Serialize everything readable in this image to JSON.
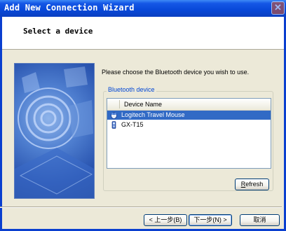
{
  "window": {
    "title": "Add New Connection Wizard",
    "close_symbol": "✕"
  },
  "header": {
    "title": "Select a device"
  },
  "main": {
    "prompt": "Please choose the Bluetooth device you wish to use.",
    "group_label": "Bluetooth device",
    "list": {
      "column_header": "Device Name",
      "items": [
        {
          "label": "Logitech Travel Mouse",
          "icon": "mouse-icon",
          "selected": true
        },
        {
          "label": "GX-T15",
          "icon": "phone-icon",
          "selected": false
        }
      ]
    },
    "refresh_button": {
      "mnemonic": "R",
      "rest": "efresh"
    }
  },
  "footer": {
    "back_label": "< 上一步(B)",
    "next_label": "下一步(N) >",
    "cancel_label": "取消"
  },
  "colors": {
    "titlebar": "#0a3fcf",
    "selection": "#316ac5",
    "group_label": "#0046d5",
    "dialog_bg": "#ece9d8"
  }
}
